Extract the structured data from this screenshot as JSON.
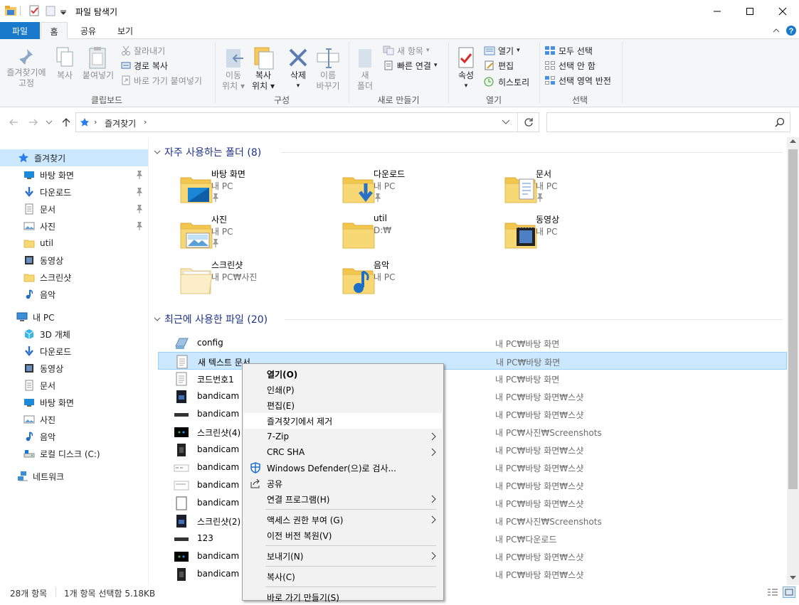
{
  "window": {
    "title": "파일 탐색기",
    "controls": {
      "minimize": "minimize-icon",
      "maximize": "maximize-icon",
      "close": "close-icon"
    }
  },
  "ribbon_tabs": [
    "파일",
    "홈",
    "공유",
    "보기"
  ],
  "ribbon": {
    "clipboard": {
      "pin_quick_access": [
        "즐겨찾기에",
        "고정"
      ],
      "copy": "복사",
      "paste": "붙여넣기",
      "cut": "잘라내기",
      "copy_path": "경로 복사",
      "paste_shortcut": "바로 가기 붙여넣기",
      "label": "클립보드"
    },
    "organize": {
      "move_to": [
        "이동",
        "위치"
      ],
      "copy_to": [
        "복사",
        "위치"
      ],
      "delete": "삭제",
      "rename": [
        "이름",
        "바꾸기"
      ],
      "label": "구성"
    },
    "new": {
      "new_folder": [
        "새",
        "폴더"
      ],
      "new_item": "새 항목",
      "easy_access": "빠른 연결",
      "label": "새로 만들기"
    },
    "open": {
      "properties": "속성",
      "open": "열기",
      "edit": "편집",
      "history": "히스토리",
      "label": "열기"
    },
    "select": {
      "select_all": "모두 선택",
      "select_none": "선택 안 함",
      "invert": "선택 영역 반전",
      "label": "선택"
    }
  },
  "address": {
    "path": "즐겨찾기",
    "search_placeholder": ""
  },
  "nav": {
    "quick_access": "즐겨찾기",
    "quick_items": [
      {
        "label": "바탕 화면",
        "icon": "desktop-icon",
        "pinned": true
      },
      {
        "label": "다운로드",
        "icon": "download-icon",
        "pinned": true
      },
      {
        "label": "문서",
        "icon": "document-icon",
        "pinned": true
      },
      {
        "label": "사진",
        "icon": "pictures-icon",
        "pinned": true
      },
      {
        "label": "util",
        "icon": "folder-icon",
        "pinned": false
      },
      {
        "label": "동영상",
        "icon": "video-icon",
        "pinned": false
      },
      {
        "label": "스크린샷",
        "icon": "folder-icon",
        "pinned": false
      },
      {
        "label": "음악",
        "icon": "music-icon",
        "pinned": false
      }
    ],
    "this_pc": "내 PC",
    "pc_items": [
      {
        "label": "3D 개체",
        "icon": "3d-objects-icon"
      },
      {
        "label": "다운로드",
        "icon": "download-icon"
      },
      {
        "label": "동영상",
        "icon": "video-icon"
      },
      {
        "label": "문서",
        "icon": "document-icon"
      },
      {
        "label": "바탕 화면",
        "icon": "desktop-icon"
      },
      {
        "label": "사진",
        "icon": "pictures-icon"
      },
      {
        "label": "음악",
        "icon": "music-icon"
      },
      {
        "label": "로컬 디스크 (C:)",
        "icon": "drive-icon"
      }
    ],
    "network": "네트워크"
  },
  "frequent": {
    "header": "자주 사용하는 폴더 (8)",
    "folders": [
      {
        "name": "바탕 화면",
        "location": "내 PC",
        "icon": "desktop-folder-icon",
        "pinned": true
      },
      {
        "name": "다운로드",
        "location": "내 PC",
        "icon": "downloads-folder-icon",
        "pinned": true
      },
      {
        "name": "문서",
        "location": "내 PC",
        "icon": "documents-folder-icon",
        "pinned": true
      },
      {
        "name": "사진",
        "location": "내 PC",
        "icon": "pictures-folder-icon",
        "pinned": true
      },
      {
        "name": "util",
        "location": "D:₩",
        "icon": "folder-icon",
        "pinned": false
      },
      {
        "name": "동영상",
        "location": "내 PC",
        "icon": "videos-folder-icon",
        "pinned": false
      },
      {
        "name": "스크린샷",
        "location": "내 PC₩사진",
        "icon": "empty-folder-icon",
        "pinned": false
      },
      {
        "name": "음악",
        "location": "내 PC",
        "icon": "music-folder-icon",
        "pinned": false
      }
    ]
  },
  "recent": {
    "header": "최근에 사용한 파일 (20)",
    "files": [
      {
        "name": "config",
        "location": "내 PC₩바탕 화면",
        "icon": "config-file-icon"
      },
      {
        "name": "새 텍스트 문서",
        "location": "내 PC₩바탕 화면",
        "icon": "text-file-icon",
        "selected": true
      },
      {
        "name": "코드번호1",
        "location": "내 PC₩바탕 화면",
        "icon": "text-file-icon"
      },
      {
        "name": "bandicam 2",
        "location": "내 PC₩바탕 화면₩스샷",
        "icon": "image-file-icon"
      },
      {
        "name": "bandicam 2",
        "location": "내 PC₩바탕 화면₩스샷",
        "icon": "image-file-icon"
      },
      {
        "name": "스크린샷(4)",
        "location": "내 PC₩사진₩Screenshots",
        "icon": "image-file-icon"
      },
      {
        "name": "bandicam 2",
        "location": "내 PC₩바탕 화면₩스샷",
        "icon": "image-file-icon"
      },
      {
        "name": "bandicam 2",
        "location": "내 PC₩바탕 화면₩스샷",
        "icon": "image-file-icon"
      },
      {
        "name": "bandicam 2",
        "location": "내 PC₩바탕 화면₩스샷",
        "icon": "image-file-icon"
      },
      {
        "name": "bandicam 2",
        "location": "내 PC₩바탕 화면₩스샷",
        "icon": "image-file-icon"
      },
      {
        "name": "스크린샷(2)",
        "location": "내 PC₩사진₩Screenshots",
        "icon": "image-file-icon"
      },
      {
        "name": "123",
        "location": "내 PC₩다운로드",
        "icon": "image-file-icon"
      },
      {
        "name": "bandicam 2",
        "location": "내 PC₩바탕 화면₩스샷",
        "icon": "image-file-icon"
      },
      {
        "name": "bandicam 2",
        "location": "내 PC₩바탕 화면₩스샷",
        "icon": "image-file-icon"
      }
    ]
  },
  "context_menu": {
    "items": [
      {
        "label": "열기(O)",
        "bold": true
      },
      {
        "label": "인쇄(P)"
      },
      {
        "label": "편집(E)"
      },
      {
        "label": "즐겨찾기에서 제거",
        "highlighted": true
      },
      {
        "label": "7-Zip",
        "submenu": true
      },
      {
        "label": "CRC SHA",
        "submenu": true
      },
      {
        "label": "Windows Defender(으)로 검사...",
        "icon": "defender-icon"
      },
      {
        "label": "공유",
        "icon": "share-icon"
      },
      {
        "label": "연결 프로그램(H)",
        "submenu": true
      },
      {
        "label": "액세스 권한 부여 (G)",
        "submenu": true
      },
      {
        "label": "이전 버전 복원(V)"
      },
      {
        "label": "보내기(N)",
        "submenu": true
      },
      {
        "label": "복사(C)"
      },
      {
        "label": "바로 가기 만들기(S)"
      }
    ]
  },
  "status": {
    "item_count": "28개 항목",
    "selection": "1개 항목 선택함 5.18KB"
  }
}
